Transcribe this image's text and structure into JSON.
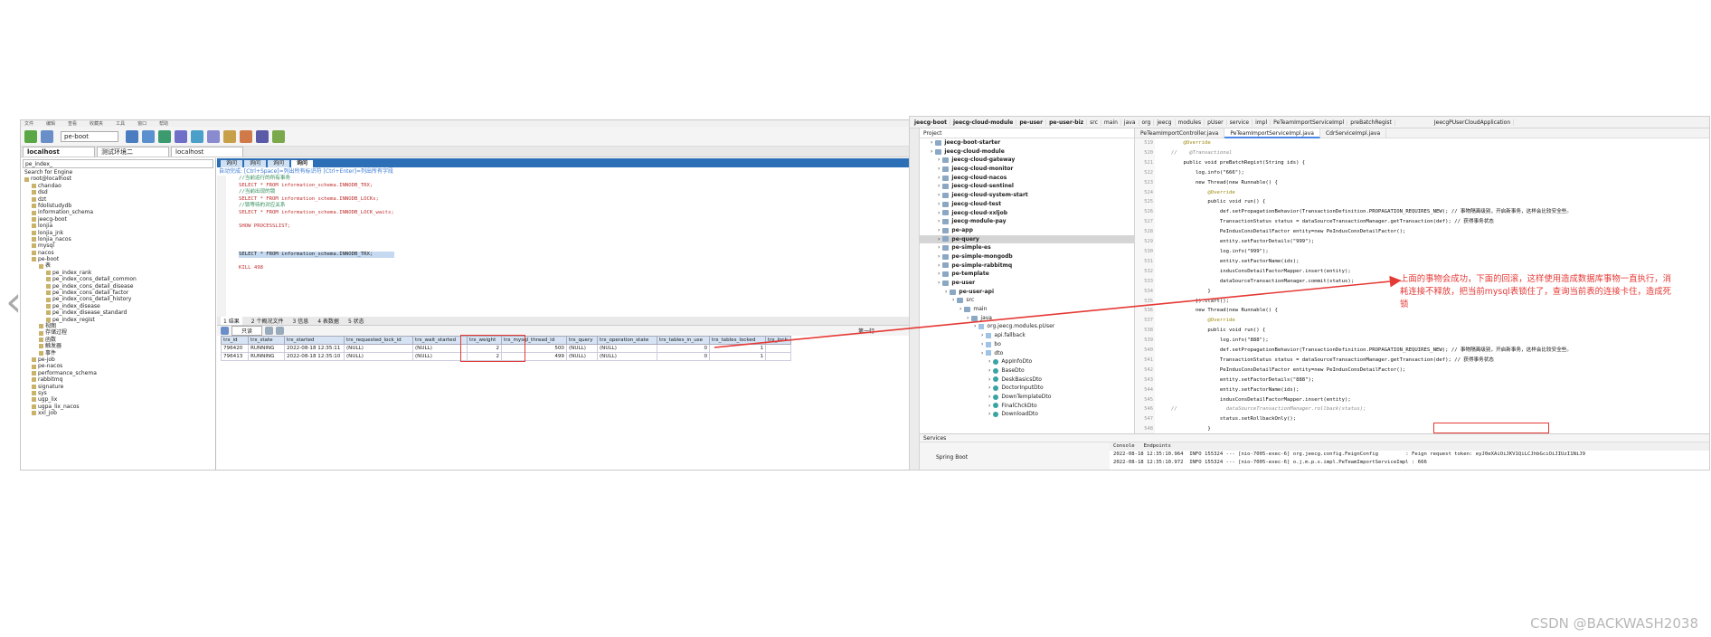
{
  "navicat": {
    "menu": [
      "文件",
      "编辑",
      "查看",
      "收藏夹",
      "工具",
      "窗口",
      "帮助"
    ],
    "db_select": "pe-boot",
    "conn_tabs": [
      "localhost",
      "测试环境二",
      "localhost"
    ],
    "tree_filter": "pe_index_",
    "tree_search": "Search for Engine",
    "tree": [
      "root@localhost",
      "chandao",
      "dsd",
      "dzt",
      "fdolistudydb",
      "information_schema",
      "jeecg-boot",
      "lonjia",
      "lonjia_jnk",
      "lonjia_nacos",
      "mysql",
      "nacos",
      "pe-boot",
      "表",
      "pe_index_rank",
      "pe_index_cons_detail_common",
      "pe_index_cons_detail_disease",
      "pe_index_cons_detail_factor",
      "pe_index_cons_detail_history",
      "pe_index_disease",
      "pe_index_disease_standard",
      "pe_index_regist",
      "视图",
      "存储过程",
      "函数",
      "触发器",
      "事件",
      "pe-job",
      "pe-nacos",
      "performance_schema",
      "rabbitmq",
      "signature",
      "sys",
      "ugp_lix",
      "ugpa_lix_nacos",
      "xxl_job"
    ],
    "query_tabs": [
      "询问",
      "询问",
      "询问",
      "询问"
    ],
    "hint": "自动完成: [Ctrl+Space]=列出所有标识符 [Ctrl+Enter]=列出所有字段",
    "code_lines": [
      {
        "t": "//当前运行的所有事务",
        "c": "c-com"
      },
      {
        "t": "SELECT * FROM information_schema.INNODB_TRX;",
        "c": "c-kw"
      },
      {
        "t": "//当前出现的锁",
        "c": "c-com"
      },
      {
        "t": "SELECT * FROM information_schema.INNODB_LOCKs;",
        "c": "c-kw"
      },
      {
        "t": "//锁等待的对应关系",
        "c": "c-com"
      },
      {
        "t": "SELECT * FROM information_schema.INNODB_LOCK_waits;",
        "c": "c-kw"
      },
      {
        "t": "",
        "c": ""
      },
      {
        "t": "SHOW  PROCESSLIST;",
        "c": "c-kw"
      },
      {
        "t": "",
        "c": ""
      },
      {
        "t": "",
        "c": ""
      },
      {
        "t": "",
        "c": ""
      },
      {
        "t": "SELECT * FROM information_schema.INNODB_TRX;",
        "c": "c-sel"
      },
      {
        "t": "",
        "c": ""
      },
      {
        "t": "KILL 498",
        "c": "c-kw"
      }
    ],
    "result_tabs": [
      "1 结果",
      "2 个概况文件",
      "3 信息",
      "4 表数据",
      "5 状态"
    ],
    "result_mode": "只读",
    "pager_label": "第一行",
    "grid_columns": [
      "trx_id",
      "trx_state",
      "trx_started",
      "trx_requested_lock_id",
      "trx_wait_started",
      "trx_weight",
      "trx_mysql_thread_id",
      "trx_query",
      "trx_operation_state",
      "trx_tables_in_use",
      "trx_tables_locked",
      "trx_lock"
    ],
    "grid_rows": [
      [
        "796420",
        "RUNNING",
        "2022-08-18 12:35:11",
        "(NULL)",
        "(NULL)",
        "2",
        "500",
        "(NULL)",
        "(NULL)",
        "0",
        "1",
        ""
      ],
      [
        "796413",
        "RUNNING",
        "2022-08-18 12:35:10",
        "(NULL)",
        "(NULL)",
        "2",
        "499",
        "(NULL)",
        "(NULL)",
        "0",
        "1",
        ""
      ]
    ]
  },
  "idea": {
    "nav": [
      "jeecg-boot",
      "jeecg-cloud-module",
      "pe-user",
      "pe-user-biz",
      "src",
      "main",
      "java",
      "org",
      "jeecg",
      "modules",
      "pUser",
      "service",
      "impl",
      "PeTeamImportServiceImpl",
      "preBatchRegist"
    ],
    "run_config": "JeecgPUserCloudApplication",
    "project_label": "Project",
    "project": [
      {
        "t": "jeecg-boot-starter",
        "d": 1,
        "k": "fold",
        "b": true
      },
      {
        "t": "jeecg-cloud-module",
        "d": 1,
        "k": "fold",
        "b": true
      },
      {
        "t": "jeecg-cloud-gateway",
        "d": 2,
        "k": "fold",
        "b": true
      },
      {
        "t": "jeecg-cloud-monitor",
        "d": 2,
        "k": "fold",
        "b": true
      },
      {
        "t": "jeecg-cloud-nacos",
        "d": 2,
        "k": "fold",
        "b": true
      },
      {
        "t": "jeecg-cloud-sentinel",
        "d": 2,
        "k": "fold",
        "b": true
      },
      {
        "t": "jeecg-cloud-system-start",
        "d": 2,
        "k": "fold",
        "b": true
      },
      {
        "t": "jeecg-cloud-test",
        "d": 2,
        "k": "fold",
        "b": true
      },
      {
        "t": "jeecg-cloud-xxljob",
        "d": 2,
        "k": "fold",
        "b": true
      },
      {
        "t": "jeecg-module-pay",
        "d": 2,
        "k": "fold",
        "b": true
      },
      {
        "t": "pe-app",
        "d": 2,
        "k": "fold",
        "b": true
      },
      {
        "t": "pe-query",
        "d": 2,
        "k": "fold",
        "b": true,
        "sel": true
      },
      {
        "t": "pe-simple-es",
        "d": 2,
        "k": "fold",
        "b": true
      },
      {
        "t": "pe-simple-mongodb",
        "d": 2,
        "k": "fold",
        "b": true
      },
      {
        "t": "pe-simple-rabbitmq",
        "d": 2,
        "k": "fold",
        "b": true
      },
      {
        "t": "pe-template",
        "d": 2,
        "k": "fold",
        "b": true
      },
      {
        "t": "pe-user",
        "d": 2,
        "k": "fold",
        "b": true
      },
      {
        "t": "pe-user-api",
        "d": 3,
        "k": "fold",
        "b": true
      },
      {
        "t": "src",
        "d": 4,
        "k": "fold"
      },
      {
        "t": "main",
        "d": 5,
        "k": "fold"
      },
      {
        "t": "java",
        "d": 6,
        "k": "fold"
      },
      {
        "t": "org.jeecg.modules.pUser",
        "d": 7,
        "k": "pkg"
      },
      {
        "t": "api.fallback",
        "d": 8,
        "k": "pkg"
      },
      {
        "t": "bo",
        "d": 8,
        "k": "pkg"
      },
      {
        "t": "dto",
        "d": 8,
        "k": "pkg"
      },
      {
        "t": "AppInfoDto",
        "d": 9,
        "k": "cls"
      },
      {
        "t": "BaseDto",
        "d": 9,
        "k": "cls"
      },
      {
        "t": "DeskBasicsDto",
        "d": 9,
        "k": "cls"
      },
      {
        "t": "DoctorInputDto",
        "d": 9,
        "k": "cls"
      },
      {
        "t": "DownTemplateDto",
        "d": 9,
        "k": "cls"
      },
      {
        "t": "FinalChckDto",
        "d": 9,
        "k": "cls"
      },
      {
        "t": "DownloadDto",
        "d": 9,
        "k": "cls"
      }
    ],
    "editor_tabs": [
      "PeTeamImportController.java",
      "PeTeamImportServiceImpl.java",
      "CdrServiceImpl.java"
    ],
    "line_numbers": [
      "519",
      "520",
      "521",
      "522",
      "523",
      "524",
      "525",
      "526",
      "527",
      "528",
      "529",
      "530",
      "531",
      "532",
      "533",
      "534",
      "535",
      "536",
      "537",
      "538",
      "539",
      "540",
      "541",
      "542",
      "543",
      "544",
      "545",
      "546",
      "547",
      "548",
      "549"
    ],
    "code_lines": [
      "    @Override",
      "//    @Transactional",
      "    public void preBatchRegist(String ids) {",
      "        log.info(\"666\");",
      "        new Thread(new Runnable() {",
      "            @Override",
      "            public void run() {",
      "                def.setPropagationBehavior(TransactionDefinition.PROPAGATION_REQUIRES_NEW); // 事物隔离级别，开启新事务，这样会比较安全些。",
      "                TransactionStatus status = dataSourceTransactionManager.getTransaction(def); // 获得事务状态",
      "                PeIndusConsDetailFactor entity=new PeIndusConsDetailFactor();",
      "                entity.setFactorDetails(\"999\");",
      "                log.info(\"999\");",
      "                entity.setFactorName(ids);",
      "                indusConsDetailFactorMapper.insert(entity);",
      "                dataSourceTransactionManager.commit(status);",
      "            }",
      "        }).start();",
      "        new Thread(new Runnable() {",
      "            @Override",
      "            public void run() {",
      "                log.info(\"888\");",
      "                def.setPropagationBehavior(TransactionDefinition.PROPAGATION_REQUIRES_NEW); // 事物隔离级别，开启新事务，这样会比较安全些。",
      "                TransactionStatus status = dataSourceTransactionManager.getTransaction(def); // 获得事务状态",
      "                PeIndusConsDetailFactor entity=new PeIndusConsDetailFactor();",
      "                entity.setFactorDetails(\"888\");",
      "                entity.setFactorName(ids);",
      "                indusConsDetailFactorMapper.insert(entity);",
      "//                dataSourceTransactionManager.rollback(status);",
      "                status.setRollbackOnly();",
      "            }",
      "        }"
    ],
    "services_label": "Services",
    "services_item": "Spring Boot",
    "console_tabs": [
      "Console",
      "Endpoints"
    ],
    "console_lines": [
      "2022-08-18 12:35:10.964  INFO 155324 --- [nio-7005-exec-6] org.jeecg.config.FeignConfig         : Feign request token: eyJ0eXAiOiJKV1QiLCJhbGciOiJIUzI1NiJ9",
      "2022-08-18 12:35:10.972  INFO 155324 --- [nio-7005-exec-6] o.j.m.p.s.impl.PeTeamImportServiceImpl : 666"
    ]
  },
  "annotation": "上面的事物会成功，下面的回滚，这样使用造成数据库事物一直执行，消耗连接不释放，把当前mysql表锁住了，查询当前表的连接卡住，造成死锁",
  "watermark": "CSDN @BACKWASH2038",
  "colors": {
    "accent_red": "#e53935",
    "navicat_blue": "#2d6fb7"
  }
}
